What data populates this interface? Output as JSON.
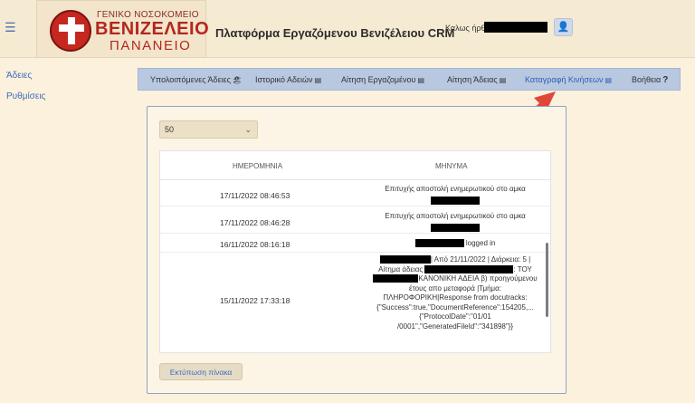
{
  "header": {
    "logo": {
      "line1": "ΓΕΝΙΚΟ ΝΟΣΟΚΟΜΕΙΟ",
      "line2": "ΒΕΝΙΖΕΛΕΙΟ",
      "line3": "ΠΑΝΑΝΕΙΟ"
    },
    "app_title": "Πλατφόρμα Εργαζόμενου Βενιζέλειου CRM",
    "welcome": "Καλως ήρθες",
    "user_icon": "user-icon"
  },
  "sidebar": {
    "items": [
      {
        "label": "Άδειες"
      },
      {
        "label": "Ρυθμίσεις"
      }
    ]
  },
  "tabs": [
    {
      "label": "Υπολοιπόμενες Άδειες",
      "icon": "🏖"
    },
    {
      "label": "Ιστορικό Αδειών",
      "icon": "▤"
    },
    {
      "label": "Αίτηση Εργαζομένου",
      "icon": "▤"
    },
    {
      "label": "Αίτηση Άδειας",
      "icon": "▤"
    },
    {
      "label": "Καταγραφή Κινήσεων",
      "icon": "▤",
      "active": true
    },
    {
      "label": "Βοήθεια",
      "icon": "?"
    }
  ],
  "page_size_select": {
    "value": "50"
  },
  "table": {
    "columns": [
      "ΗΜΕΡΟΜΗΝΙΑ",
      "ΜΗΝΥΜΑ"
    ],
    "rows": [
      {
        "date": "17/11/2022 08:46:53",
        "message": "Επιτυχής αποστολή ενημερωτικού στο αμκα"
      },
      {
        "date": "17/11/2022 08:46:28",
        "message": "Επιτυχής αποστολή ενημερωτικού στο αμκα"
      },
      {
        "date": "16/11/2022 08:16:18",
        "message": "logged in"
      },
      {
        "date": "15/11/2022 17:33:18",
        "message_lines": [
          "| Από 21/11/2022 | Διάρκεια: 5 |",
          "Αίτημα άδειας",
          ": ΤΟΥ",
          "ΚΑΝΟΝΙΚΗ ΑΔΕΙΑ β) προηγούμενου",
          "έτους απο μεταφορά |Τμήμα:",
          "ΠΛΗΡΟΦΟΡΙΚΗ|Response from docutracks:",
          "{\"Success\":true,\"DocumentReference\":154205,...",
          "{\"ProtocolDate\":\"01/01",
          "/0001\",\"GeneratedFileId\":\"341898\"}}"
        ]
      }
    ]
  },
  "print_button": {
    "label": "Εκτύπωση πίνακα"
  },
  "colors": {
    "accent": "#3a6cc2",
    "tabbar": "#b8c8e0",
    "background": "#fbf1dc",
    "annotation_arrow": "#e0463a"
  }
}
